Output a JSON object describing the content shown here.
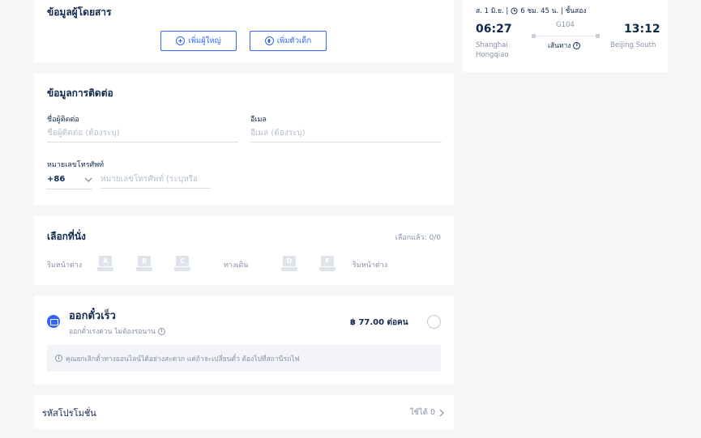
{
  "passenger": {
    "title": "ข้อมูลผู้โดยสาร",
    "add_adult": "เพิ่มผู้ใหญ่",
    "add_child": "เพิ่มตัวเด็ก"
  },
  "contact": {
    "title": "ข้อมูลการติดต่อ",
    "name_label": "ชื่อผู้ติดต่อ",
    "name_placeholder": "ชื่อผู้ติดต่อ (ต้องระบุ)",
    "email_label": "อีเมล",
    "email_placeholder": "อีเมล (ต้องระบุ)",
    "phone_label": "หมายเลขโทรศัพท์",
    "country_code": "+86",
    "phone_placeholder": "หมายเลขโทรศัพท์ (ระบุหรือ"
  },
  "seat": {
    "title": "เลือกที่นั่ง",
    "selected": "เลือกแล้ว: 0/0",
    "window_left": "ริมหน้าต่าง",
    "aisle": "ทางเดิน",
    "window_right": "ริมหน้าต่าง",
    "seats": [
      "A",
      "B",
      "C",
      "D",
      "F"
    ]
  },
  "fast_ticket": {
    "title": "ออกตั๋วเร็ว",
    "subtitle": "ออกตั๋วเร่งด่วน ไม่ต้องรอนาน",
    "price": "฿ 77.00 ต่อคน",
    "note": "คุณยกเลิกตั๋วทางออนไลน์ได้อย่างสะดวก แต่ถ้าจะเปลี่ยนตั๋ว ต้องไปที่สถานีรถไฟ"
  },
  "promo": {
    "label": "รหัสโปรโมชั่น",
    "available": "ใช้ได้ 0"
  },
  "trip": {
    "date": "ส. 1 มิ.ย. |",
    "duration": "6 ชม. 45 น. | ชั้นสอง",
    "depart_time": "06:27",
    "depart_station_line1": "Shanghai",
    "depart_station_line2": "Hongqiao",
    "train_no": "G104",
    "route_link": "เส้นทาง",
    "arrive_time": "13:12",
    "arrive_station": "Beijing South"
  },
  "colors": {
    "accent": "#3264ff",
    "text": "#0f294d",
    "muted": "#8592a6",
    "background": "#f5f6f8"
  }
}
